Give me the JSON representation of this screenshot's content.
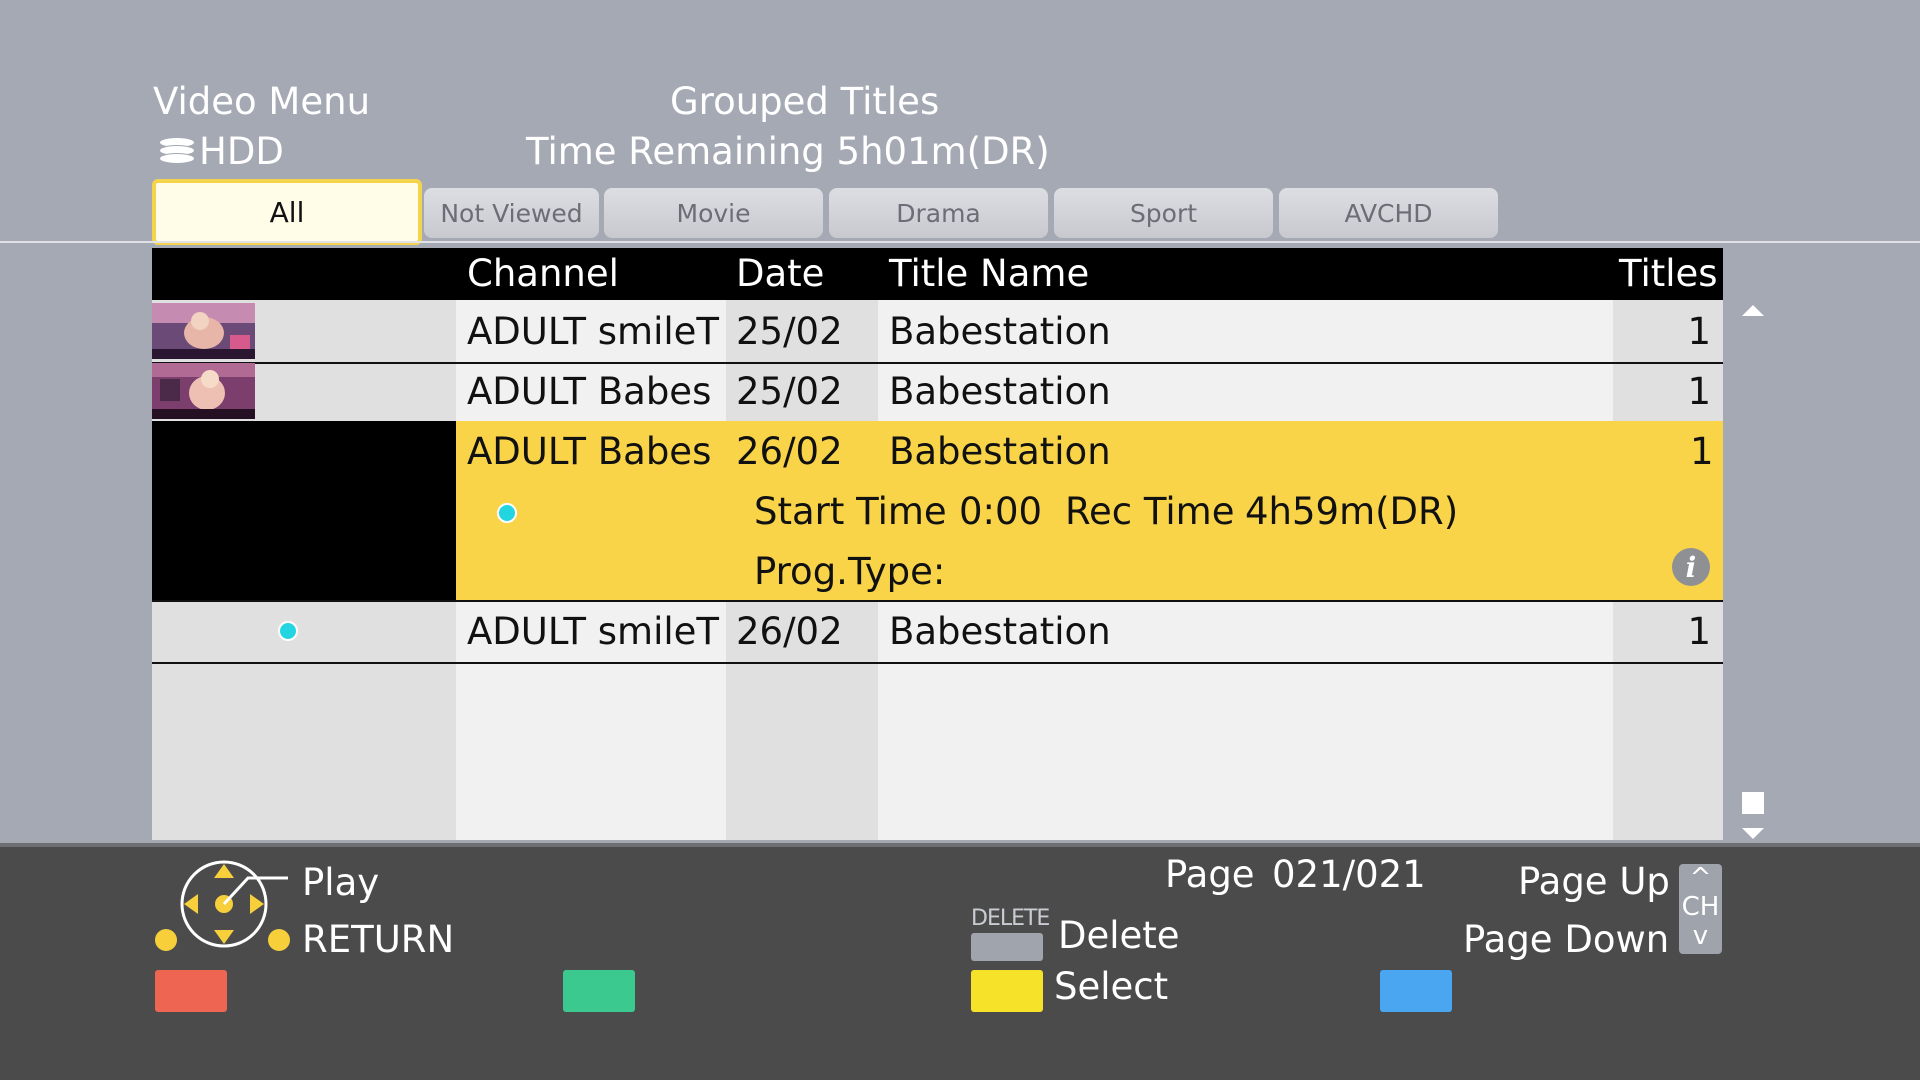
{
  "header": {
    "menu_title": "Video Menu",
    "drive_icon": "hdd-stack-icon",
    "drive_label": "HDD",
    "view_title": "Grouped Titles",
    "time_remaining": "Time Remaining 5h01m(DR)"
  },
  "tabs": [
    {
      "label": "All",
      "active": true
    },
    {
      "label": "Not Viewed",
      "active": false
    },
    {
      "label": "Movie",
      "active": false
    },
    {
      "label": "Drama",
      "active": false
    },
    {
      "label": "Sport",
      "active": false
    },
    {
      "label": "AVCHD",
      "active": false
    }
  ],
  "table": {
    "headers": {
      "channel": "Channel",
      "date": "Date",
      "title_name": "Title Name",
      "titles": "Titles"
    },
    "rows": [
      {
        "channel": "ADULT smileT",
        "date": "25/02",
        "title": "Babestation",
        "titles": "1",
        "thumbnail": true
      },
      {
        "channel": "ADULT Babes",
        "date": "25/02",
        "title": "Babestation",
        "titles": "1",
        "thumbnail": true
      },
      {
        "channel": "ADULT Babes",
        "date": "26/02",
        "title": "Babestation",
        "titles": "1",
        "selected": true
      },
      {
        "channel": "ADULT smileT",
        "date": "26/02",
        "title": "Babestation",
        "titles": "1",
        "new_marker": true
      }
    ],
    "selected_detail": {
      "start_label": "Start Time",
      "start_value": "0:00",
      "rec_label": "Rec Time",
      "rec_value": "4h59m(DR)",
      "prog_type_label": "Prog.Type:",
      "info_icon_glyph": "i"
    }
  },
  "footer": {
    "play_label": "Play",
    "return_label": "RETURN",
    "page_label": "Page",
    "page_value": "021/021",
    "delete_key_label": "DELETE",
    "delete_label": "Delete",
    "select_label": "Select",
    "page_up_label": "Page Up",
    "page_down_label": "Page Down",
    "ch_up": "^",
    "ch_label": "CH",
    "ch_down": "v"
  },
  "colors": {
    "background": "#a5a9b4",
    "selection": "#f9d448",
    "tab_active_border": "#f4d44c",
    "red_button": "#ee6552",
    "green_button": "#3cc98f",
    "yellow_button": "#f7e22a",
    "blue_button": "#4aa6f0",
    "new_dot": "#22d5e0"
  }
}
